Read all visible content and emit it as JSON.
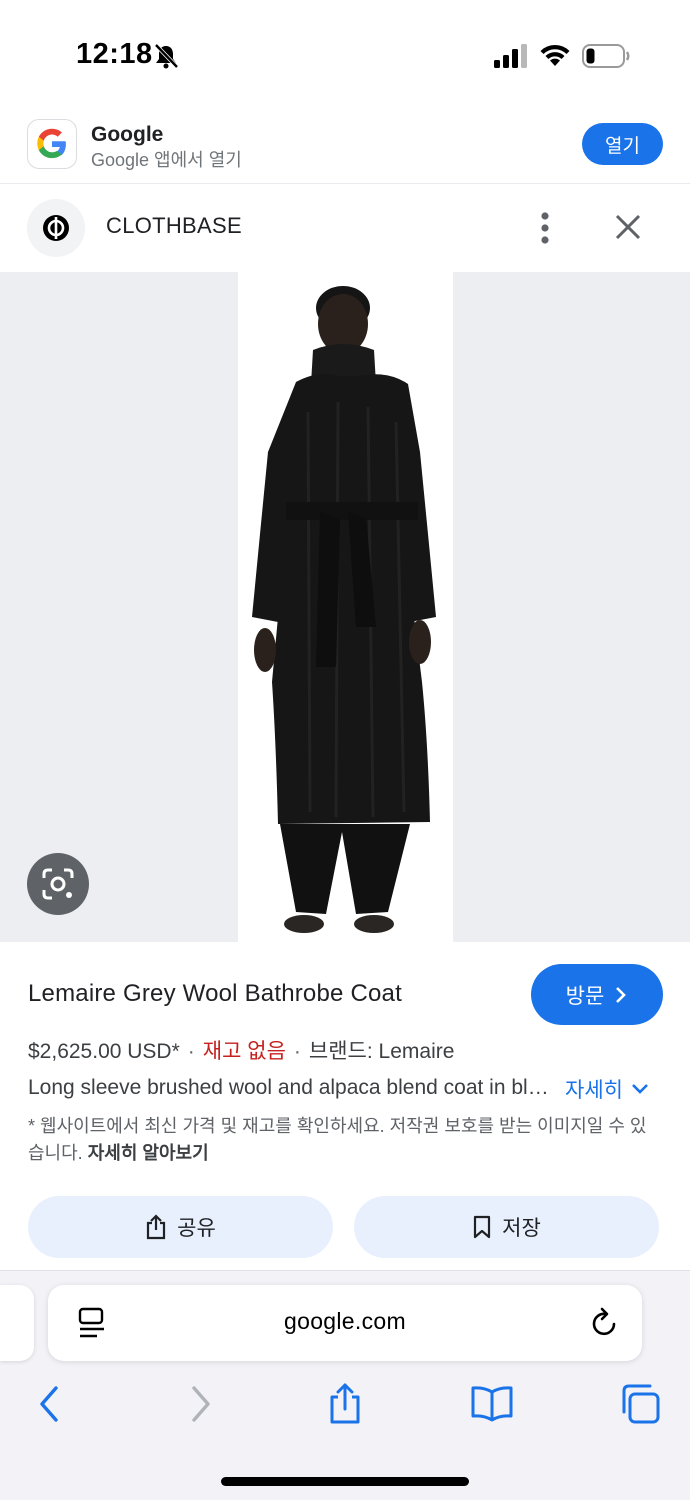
{
  "status_bar": {
    "time": "12:18"
  },
  "app_banner": {
    "app_name": "Google",
    "subtitle": "Google 앱에서 열기",
    "open_label": "열기"
  },
  "site": {
    "name": "CLOTHBASE"
  },
  "product": {
    "title": "Lemaire Grey Wool Bathrobe Coat",
    "visit_label": "방문",
    "price": "$2,625.00 USD*",
    "stock": "재고 없음",
    "brand": "브랜드: Lemaire",
    "description": "Long sleeve brushed wool and alpaca blend coat in black. Stand collar, concealed front closure, belted waist.",
    "more_label": "자세히",
    "note": "* 웹사이트에서 최신 가격 및 재고를 확인하세요. 저작권 보호를 받는 이미지일 수 있습니다.",
    "learn_more": "자세히 알아보기"
  },
  "actions": {
    "share_label": "공유",
    "save_label": "저장"
  },
  "browser": {
    "url": "google.com"
  },
  "colors": {
    "accent": "#1a73e8",
    "stock_out": "#c5221f",
    "button_tint": "#e8f0fe"
  },
  "icons": [
    "bell-slash-icon",
    "signal-icon",
    "wifi-icon",
    "battery-icon",
    "google-logo-icon",
    "more-vert-icon",
    "close-icon",
    "lens-icon",
    "chevron-right-icon",
    "chevron-down-icon",
    "share-icon",
    "bookmark-icon",
    "reader-icon",
    "reload-icon",
    "back-icon",
    "forward-icon",
    "safari-share-icon",
    "bookmarks-icon",
    "tabs-icon"
  ]
}
